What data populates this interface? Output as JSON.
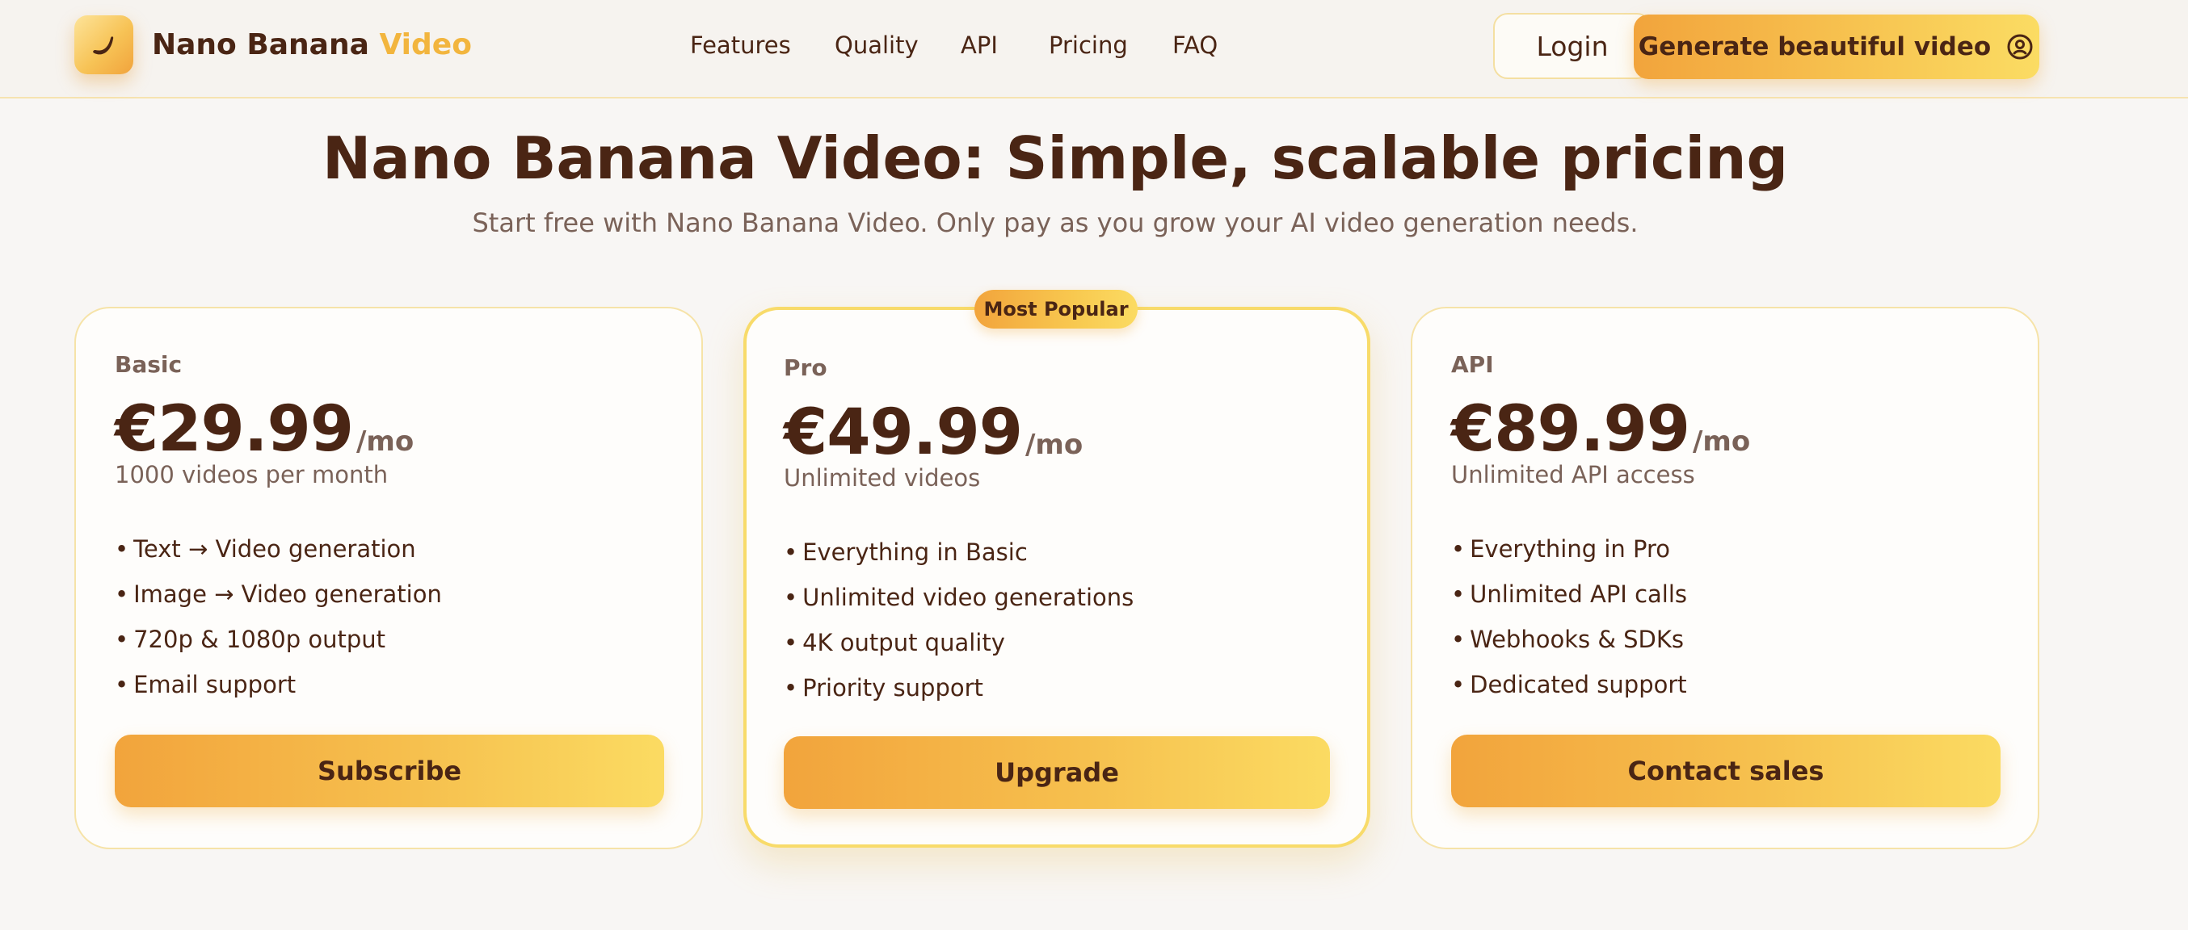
{
  "header": {
    "brand_main": "Nano Banana ",
    "brand_accent": "Video",
    "nav": [
      "Features",
      "Quality",
      "API",
      "Pricing",
      "FAQ"
    ],
    "login_label": "Login",
    "cta_label": "Generate beautiful video"
  },
  "hero": {
    "title": "Nano Banana Video: Simple, scalable pricing",
    "subtitle": "Start free with Nano Banana Video. Only pay as you grow your AI video generation needs."
  },
  "pricing": {
    "popular_badge": "Most Popular",
    "plans": [
      {
        "name": "Basic",
        "price": "€29.99",
        "period": "/mo",
        "description": "1000 videos per month",
        "features": [
          "Text → Video generation",
          "Image → Video generation",
          "720p & 1080p output",
          "Email support"
        ],
        "button": "Subscribe"
      },
      {
        "name": "Pro",
        "price": "€49.99",
        "period": "/mo",
        "description": "Unlimited videos",
        "features": [
          "Everything in Basic",
          "Unlimited video generations",
          "4K output quality",
          "Priority support"
        ],
        "button": "Upgrade"
      },
      {
        "name": "API",
        "price": "€89.99",
        "period": "/mo",
        "description": "Unlimited API access",
        "features": [
          "Everything in Pro",
          "Unlimited API calls",
          "Webhooks & SDKs",
          "Dedicated support"
        ],
        "button": "Contact sales"
      }
    ]
  },
  "colors": {
    "accent": "#f2b53e",
    "text": "#4a2514",
    "muted": "#7a6258",
    "background": "#f8f6f4"
  },
  "icons": {
    "logo": "banana-icon",
    "cta": "user-circle-icon"
  }
}
